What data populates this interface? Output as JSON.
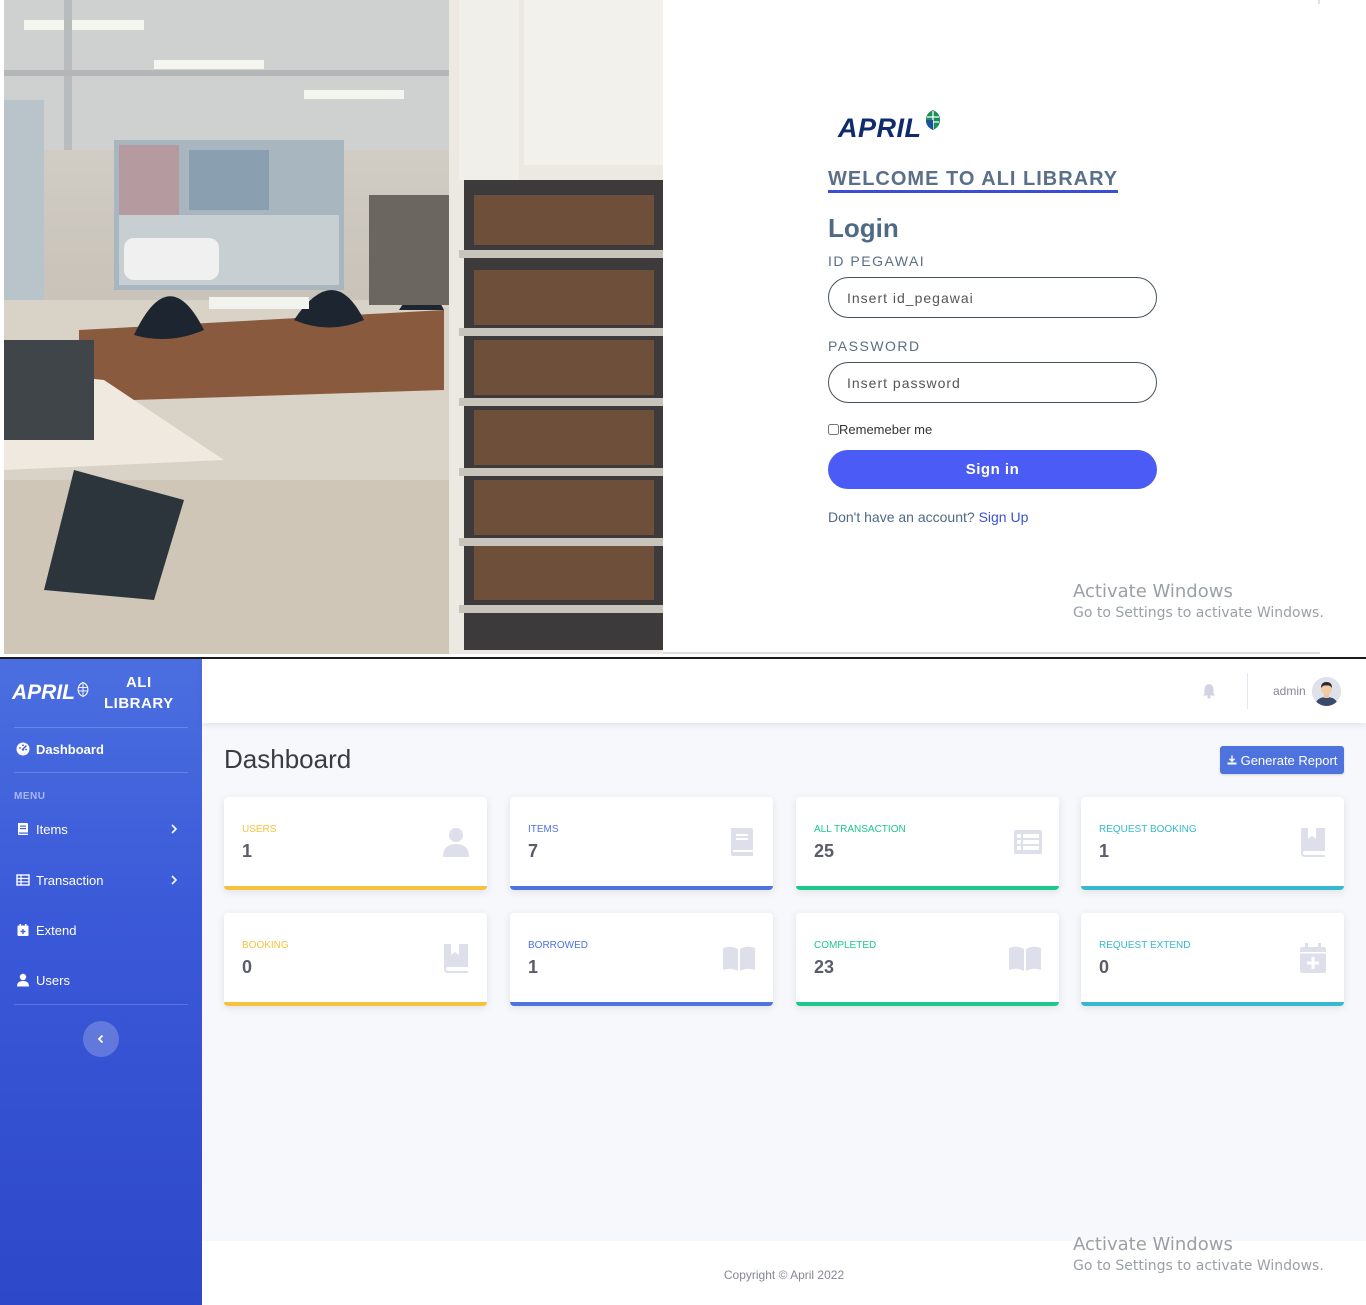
{
  "login": {
    "brand": {
      "logo_text": "APRIL"
    },
    "welcome": "WELCOME TO ALI LIBRARY",
    "heading": "Login",
    "id_label": "ID PEGAWAI",
    "id_placeholder": "Insert id_pegawai",
    "password_label": "PASSWORD",
    "password_placeholder": "Insert password",
    "remember_label": "Rememeber me",
    "signin_label": "Sign in",
    "signup_prompt": "Don't have an account?",
    "signup_link": "Sign Up"
  },
  "watermark": {
    "title": "Activate Windows",
    "subtitle": "Go to Settings to activate Windows."
  },
  "dashboard": {
    "brand": {
      "logo_text": "APRIL",
      "name_line1": "ALI",
      "name_line2": "LIBRARY"
    },
    "sidebar": {
      "menu_heading": "MENU",
      "items": [
        {
          "label": "Dashboard",
          "icon": "tachometer-icon"
        },
        {
          "label": "Items",
          "icon": "book-icon"
        },
        {
          "label": "Transaction",
          "icon": "table-icon"
        },
        {
          "label": "Extend",
          "icon": "calendar-plus-icon"
        },
        {
          "label": "Users",
          "icon": "user-icon"
        }
      ]
    },
    "topbar": {
      "user_name": "admin"
    },
    "page_title": "Dashboard",
    "report_button": "Generate Report",
    "cards": [
      {
        "label": "USERS",
        "value": "1",
        "color": "#f6c23e",
        "icon": "user-icon"
      },
      {
        "label": "ITEMS",
        "value": "7",
        "color": "#4e73df",
        "icon": "book-icon"
      },
      {
        "label": "ALL TRANSACTION",
        "value": "25",
        "color": "#1cc88a",
        "icon": "list-icon"
      },
      {
        "label": "REQUEST BOOKING",
        "value": "1",
        "color": "#36b9cc",
        "icon": "bookmark-book-icon"
      },
      {
        "label": "BOOKING",
        "value": "0",
        "color": "#f6c23e",
        "icon": "bookmark-book-icon"
      },
      {
        "label": "BORROWED",
        "value": "1",
        "color": "#4e73df",
        "icon": "open-book-icon"
      },
      {
        "label": "COMPLETED",
        "value": "23",
        "color": "#1cc88a",
        "icon": "open-book-icon"
      },
      {
        "label": "REQUEST EXTEND",
        "value": "0",
        "color": "#36b9cc",
        "icon": "calendar-plus-icon"
      }
    ],
    "footer": "Copyright © April 2022"
  }
}
